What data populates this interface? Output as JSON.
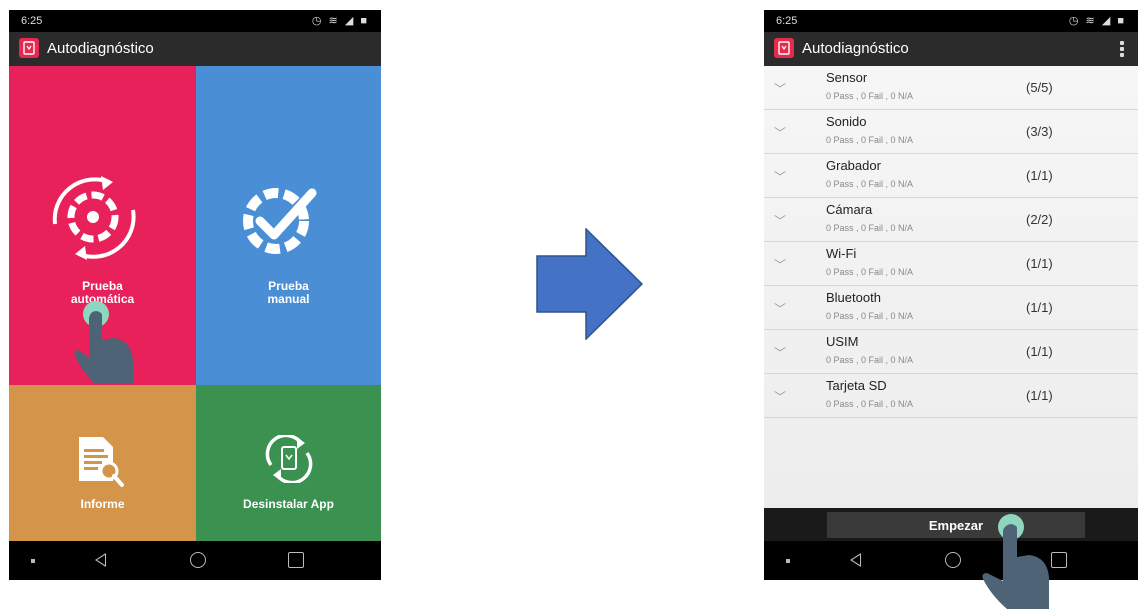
{
  "status_bar": {
    "time": "6:25",
    "icons": "◷ ≋ ◢ ■"
  },
  "app": {
    "title": "Autodiagnóstico"
  },
  "left_screen": {
    "tiles": {
      "auto": {
        "line1": "Prueba",
        "line2": "automática",
        "color": "#e8215a"
      },
      "manual": {
        "line1": "Prueba",
        "line2": "manual",
        "color": "#4a8fd6"
      },
      "report": {
        "label": "Informe",
        "color": "#d4954a"
      },
      "uninstall": {
        "label": "Desinstalar App",
        "color": "#3a9150"
      }
    }
  },
  "right_screen": {
    "rows": [
      {
        "name": "Sensor",
        "stats": "0 Pass , 0 Fail , 0 N/A",
        "count": "(5/5)"
      },
      {
        "name": "Sonido",
        "stats": "0 Pass , 0 Fail , 0 N/A",
        "count": "(3/3)"
      },
      {
        "name": "Grabador",
        "stats": "0 Pass , 0 Fail , 0 N/A",
        "count": "(1/1)"
      },
      {
        "name": "Cámara",
        "stats": "0 Pass , 0 Fail , 0 N/A",
        "count": "(2/2)"
      },
      {
        "name": "Wi-Fi",
        "stats": "0 Pass , 0 Fail , 0 N/A",
        "count": "(1/1)"
      },
      {
        "name": "Bluetooth",
        "stats": "0 Pass , 0 Fail , 0 N/A",
        "count": "(1/1)"
      },
      {
        "name": "USIM",
        "stats": "0 Pass , 0 Fail , 0 N/A",
        "count": "(1/1)"
      },
      {
        "name": "Tarjeta SD",
        "stats": "0 Pass , 0 Fail , 0 N/A",
        "count": "(1/1)"
      }
    ],
    "start_label": "Empezar",
    "chevron": "﹀"
  },
  "icons": {
    "transition": "arrow-right-icon",
    "hand": "tap-hand-icon"
  },
  "colors": {
    "arrow": "#4472c4",
    "hand": "#4f6377",
    "tap": "#8fd6c0"
  }
}
